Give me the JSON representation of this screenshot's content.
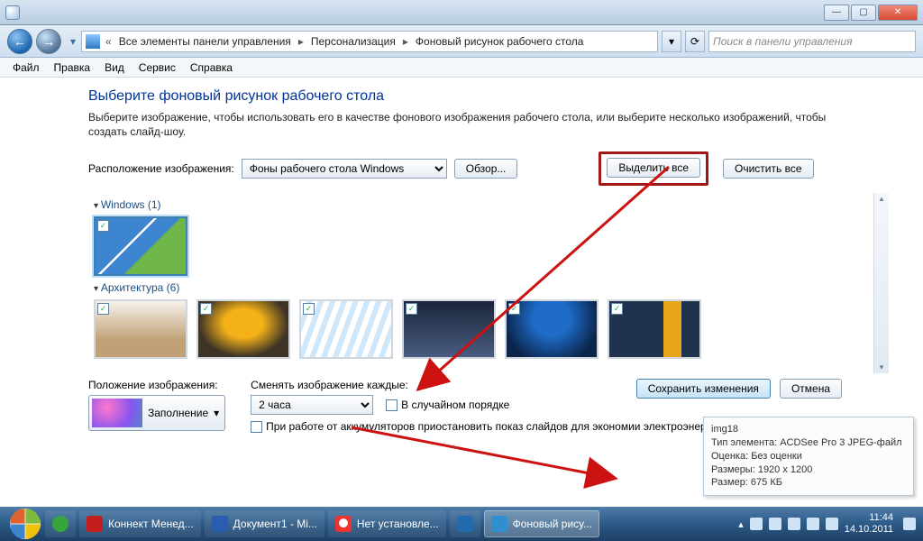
{
  "titlebar": {
    "min": "—",
    "max": "▢",
    "close": "✕"
  },
  "nav": {
    "crumbs": [
      "Все элементы панели управления",
      "Персонализация",
      "Фоновый рисунок рабочего стола"
    ],
    "refresh": "⟳",
    "search_placeholder": "Поиск в панели управления"
  },
  "menu": [
    "Файл",
    "Правка",
    "Вид",
    "Сервис",
    "Справка"
  ],
  "page": {
    "title": "Выберите фоновый рисунок рабочего стола",
    "intro": "Выберите изображение, чтобы использовать его в качестве фонового изображения рабочего стола, или выберите несколько изображений, чтобы создать слайд-шоу.",
    "loc_label": "Расположение изображения:",
    "loc_value": "Фоны рабочего стола Windows",
    "browse": "Обзор...",
    "select_all": "Выделить все",
    "clear_all": "Очистить все",
    "cat1": "Windows (1)",
    "cat2": "Архитектура (6)",
    "pos_label": "Положение изображения:",
    "pos_value": "Заполнение",
    "interval_label": "Сменять изображение каждые:",
    "interval_value": "2 часа",
    "shuffle": "В случайном порядке",
    "battery": "При работе от аккумуляторов приостановить показ слайдов для экономии электроэнергии",
    "save": "Сохранить изменения",
    "cancel": "Отмена"
  },
  "tooltip": {
    "l1": "img18",
    "l2": "Тип элемента: ACDSee Pro 3 JPEG-файл",
    "l3": "Оценка: Без оценки",
    "l4": "Размеры: 1920 x 1200",
    "l5": "Размер: 675 КБ"
  },
  "taskbar": {
    "items": [
      {
        "label": ""
      },
      {
        "label": "Коннект Менед..."
      },
      {
        "label": "Документ1 - Mi..."
      },
      {
        "label": "Нет установле..."
      },
      {
        "label": ""
      },
      {
        "label": "Фоновый рису..."
      }
    ],
    "time": "11:44",
    "date": "14.10.2011"
  }
}
